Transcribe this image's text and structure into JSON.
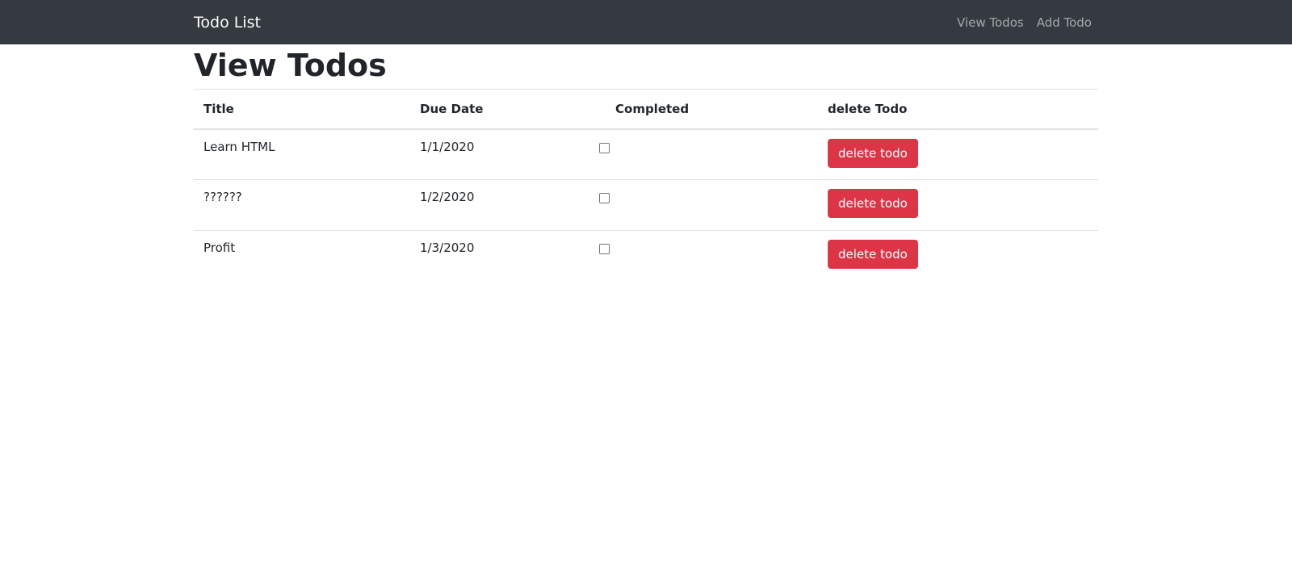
{
  "navbar": {
    "brand": "Todo List",
    "links": [
      {
        "label": "View Todos"
      },
      {
        "label": "Add Todo"
      }
    ],
    "background_color": "#343a40"
  },
  "page": {
    "title": "View Todos"
  },
  "table": {
    "headers": {
      "title": "Title",
      "due_date": "Due Date",
      "completed": "Completed",
      "delete": "delete Todo"
    },
    "rows": [
      {
        "title": "Learn HTML",
        "due_date": "1/1/2020",
        "completed": false,
        "action": "delete todo"
      },
      {
        "title": "??????",
        "due_date": "1/2/2020",
        "completed": false,
        "action": "delete todo"
      },
      {
        "title": "Profit",
        "due_date": "1/3/2020",
        "completed": false,
        "action": "delete todo"
      }
    ],
    "delete_button_color": "#dc3545"
  }
}
